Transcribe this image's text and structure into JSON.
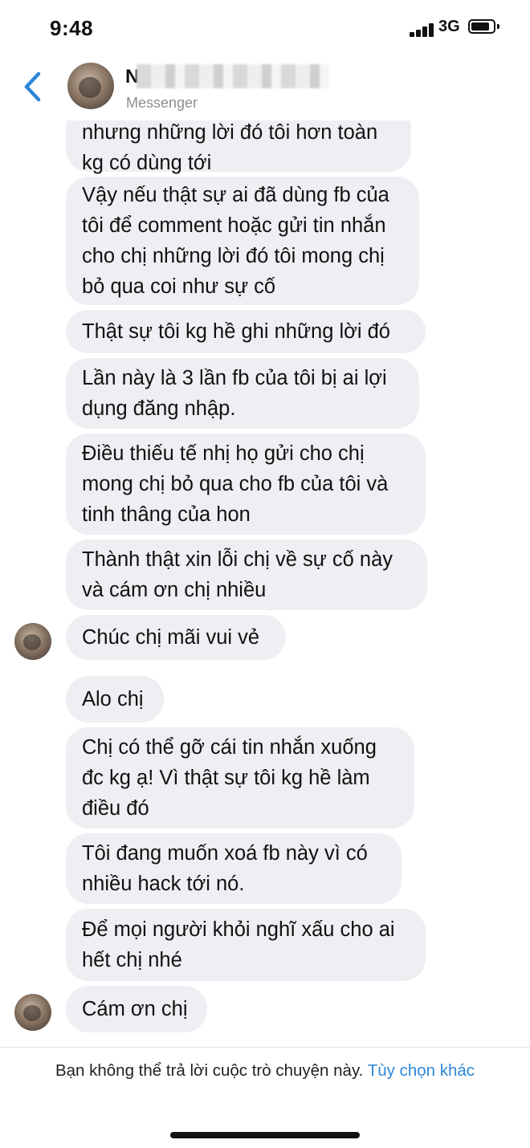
{
  "status_bar": {
    "time": "9:48",
    "network": "3G"
  },
  "header": {
    "contact_name": "N",
    "subtitle": "Messenger"
  },
  "messages": [
    {
      "lines": [
        "nhưng những lời đó tôi hơn toàn",
        "kg có dùng tới"
      ]
    },
    {
      "lines": [
        "Vậy nếu thật sự ai đã dùng fb của",
        "tôi để comment hoặc gửi tin nhắn",
        "cho chị những lời đó tôi mong chị",
        "bỏ qua coi như sự cố"
      ]
    },
    {
      "lines": [
        "Thật sự tôi kg hề ghi những lời đó"
      ]
    },
    {
      "lines": [
        "Lần này là 3 lần fb của tôi bị ai lợi",
        "dụng đăng nhập."
      ]
    },
    {
      "lines": [
        "Điều thiếu tế nhị họ gửi cho chị",
        "mong chị bỏ qua cho fb của tôi và",
        "tinh thâng của hon"
      ]
    },
    {
      "lines": [
        "Thành thật xin lỗi chị về sự cố này",
        "và cám ơn chị nhiều"
      ]
    },
    {
      "lines": [
        "Chúc chị mãi vui vẻ"
      ]
    },
    {
      "lines": [
        "Alo chị"
      ]
    },
    {
      "lines": [
        "Chị có thể gỡ cái tin nhắn xuống",
        "đc kg ạ! Vì thật sự tôi kg hề làm",
        "điều đó"
      ]
    },
    {
      "lines": [
        "Tôi đang muốn xoá fb này vì có",
        "nhiều hack tới nó."
      ]
    },
    {
      "lines": [
        "Để mọi người khỏi nghĩ xấu cho ai",
        "hết chị nhé"
      ]
    },
    {
      "lines": [
        "Cám ơn chị"
      ]
    }
  ],
  "footer": {
    "text": "Bạn không thể trả lời cuộc trò chuyện này.",
    "link": "Tùy chọn khác"
  },
  "colors": {
    "bubble": "#eeeff2",
    "link": "#2d87d8",
    "back": "#2d87d8"
  }
}
